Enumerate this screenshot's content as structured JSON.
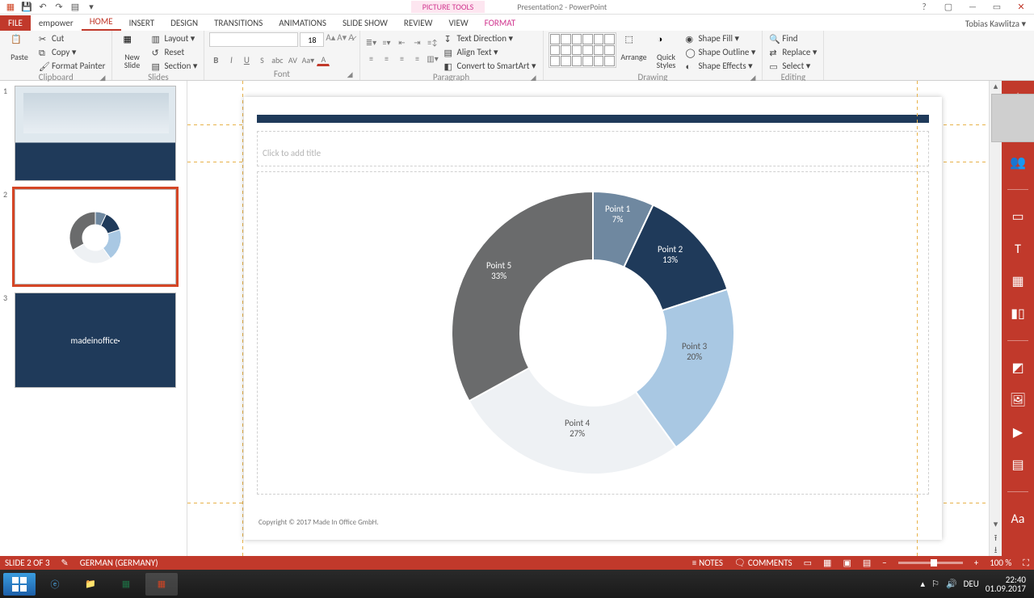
{
  "titlebar": {
    "contextual_tab": "PICTURE TOOLS",
    "presentation_name": "Presentation2 - PowerPoint"
  },
  "window_controls": {
    "help": "?",
    "ribbon_options": "▢",
    "minimize": "—",
    "restore": "▭",
    "close": "✕"
  },
  "account_name": "Tobias Kawlitza ▾",
  "tabs": {
    "file": "FILE",
    "empower": "empower",
    "home": "HOME",
    "insert": "INSERT",
    "design": "DESIGN",
    "transitions": "TRANSITIONS",
    "animations": "ANIMATIONS",
    "slideshow": "SLIDE SHOW",
    "review": "REVIEW",
    "view": "VIEW",
    "format": "FORMAT"
  },
  "ribbon": {
    "clipboard": {
      "paste": "Paste",
      "cut": "Cut",
      "copy": "Copy ▾",
      "format_painter": "Format Painter",
      "group": "Clipboard"
    },
    "slides": {
      "new_slide": "New\nSlide",
      "layout": "Layout ▾",
      "reset": "Reset",
      "section": "Section ▾",
      "group": "Slides"
    },
    "font": {
      "size": "18",
      "group": "Font"
    },
    "paragraph": {
      "text_direction": "Text Direction ▾",
      "align_text": "Align Text ▾",
      "smartart": "Convert to SmartArt ▾",
      "group": "Paragraph"
    },
    "drawing": {
      "arrange": "Arrange",
      "quick_styles": "Quick\nStyles",
      "shape_fill": "Shape Fill ▾",
      "shape_outline": "Shape Outline ▾",
      "shape_effects": "Shape Effects ▾",
      "group": "Drawing"
    },
    "editing": {
      "find": "Find",
      "replace": "Replace ▾",
      "select": "Select ▾",
      "group": "Editing"
    }
  },
  "thumbs": {
    "n1": "1",
    "n2": "2",
    "n3": "3",
    "logo": "madeinoffice"
  },
  "slide": {
    "title_placeholder": "Click to add title",
    "copyright": "Copyright © 2017 Made In Office GmbH."
  },
  "chart_data": {
    "type": "pie",
    "title": "",
    "series": [
      {
        "name": "",
        "values": [
          7,
          13,
          20,
          27,
          33
        ]
      }
    ],
    "categories": [
      "Point 1",
      "Point 2",
      "Point 3",
      "Point 4",
      "Point 5"
    ],
    "labels": [
      {
        "name": "Point 1",
        "pct": "7%"
      },
      {
        "name": "Point 2",
        "pct": "13%"
      },
      {
        "name": "Point 3",
        "pct": "20%"
      },
      {
        "name": "Point 4",
        "pct": "27%"
      },
      {
        "name": "Point 5",
        "pct": "33%"
      }
    ],
    "colors": [
      "#6f88a0",
      "#1f3a5a",
      "#a9c8e3",
      "#eef1f4",
      "#6a6b6c"
    ]
  },
  "statusbar": {
    "slide_indicator": "SLIDE 2 OF 3",
    "language": "GERMAN (GERMANY)",
    "notes": "NOTES",
    "comments": "COMMENTS",
    "zoom": "100 %"
  },
  "tray": {
    "lang": "DEU",
    "time": "22:40",
    "date": "01.09.2017"
  }
}
